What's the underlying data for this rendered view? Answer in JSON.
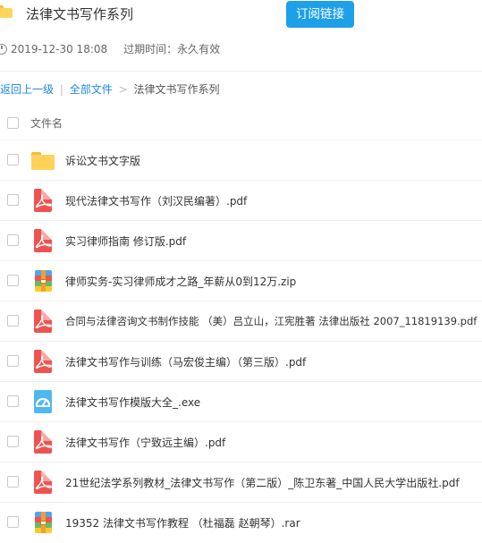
{
  "header": {
    "title": "法律文书写作系列",
    "subscribe_label": "订阅链接"
  },
  "meta": {
    "date": "2019-12-30 18:08",
    "expire_label": "过期时间：",
    "expire_value": "永久有效"
  },
  "breadcrumb": {
    "back": "返回上一级",
    "sep1": "|",
    "all": "全部文件",
    "sep2": ">",
    "current": "法律文书写作系列"
  },
  "list": {
    "column_name": "文件名",
    "files": [
      {
        "name": "诉讼文书文字版",
        "icon": "folder-icon"
      },
      {
        "name": "现代法律文书写作（刘汉民编著）.pdf",
        "icon": "pdf-icon"
      },
      {
        "name": "实习律师指南 修订版.pdf",
        "icon": "pdf-icon"
      },
      {
        "name": "律师实务-实习律师成才之路_年薪从0到12万.zip",
        "icon": "zip-icon"
      },
      {
        "name": "合同与法律咨询文书制作技能 （美）吕立山，江宪胜著 法律出版社 2007_11819139.pdf",
        "icon": "pdf-icon"
      },
      {
        "name": "法律文书写作与训练（马宏俊主编）（第三版）.pdf",
        "icon": "pdf-icon"
      },
      {
        "name": "法律文书写作模版大全_.exe",
        "icon": "exe-icon"
      },
      {
        "name": "法律文书写作（宁致远主编）.pdf",
        "icon": "pdf-icon"
      },
      {
        "name": "21世纪法学系列教材_法律文书写作（第二版）_陈卫东著_中国人民大学出版社.pdf",
        "icon": "pdf-icon"
      },
      {
        "name": "19352 法律文书写作教程 （杜福磊 赵朝琴）.rar",
        "icon": "rar-icon"
      }
    ]
  },
  "colors": {
    "accent": "#1ea0e8",
    "link": "#1e88e5",
    "pdf": "#ef5350",
    "folder": "#ffd15a"
  }
}
